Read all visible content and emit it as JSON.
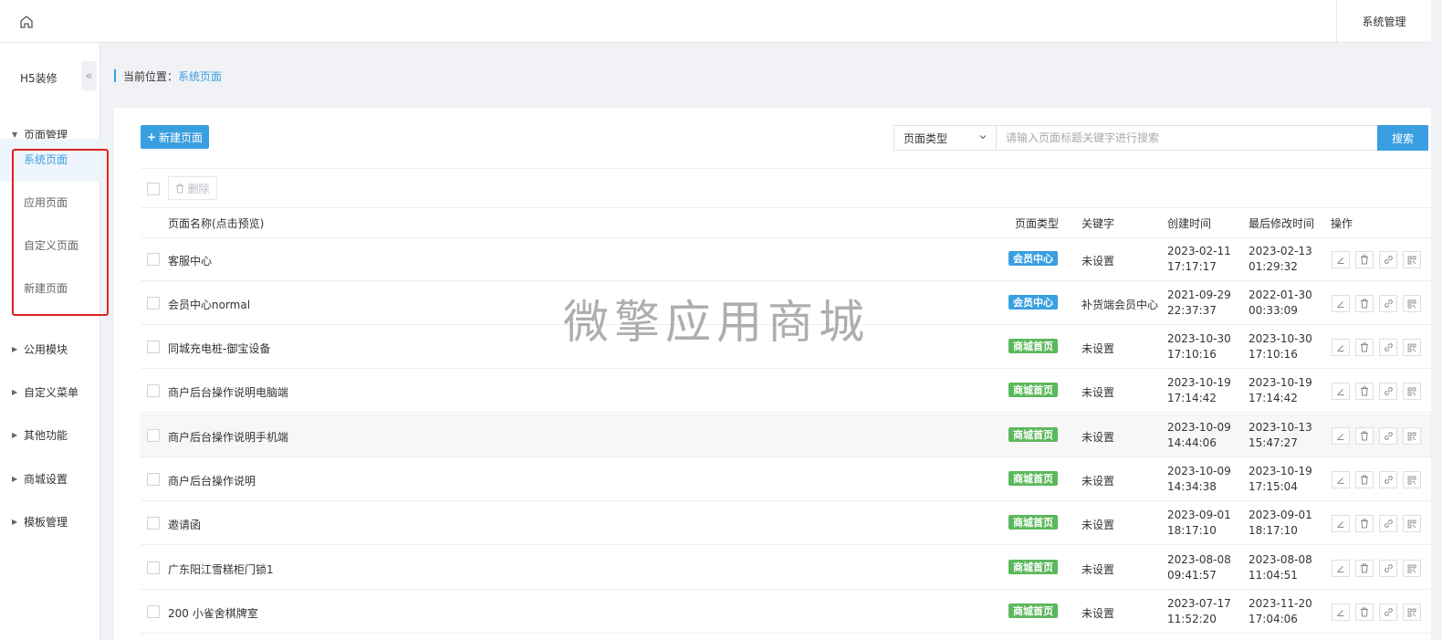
{
  "topbar": {
    "right_label": "系统管理"
  },
  "sidebar": {
    "brand": "H5装修",
    "collapse_glyph": "«",
    "groups": [
      {
        "label": "页面管理",
        "expanded": true
      },
      {
        "label": "公用模块"
      },
      {
        "label": "自定义菜单"
      },
      {
        "label": "其他功能"
      },
      {
        "label": "商城设置"
      },
      {
        "label": "模板管理"
      }
    ],
    "sub_items": [
      {
        "label": "系统页面",
        "active": true
      },
      {
        "label": "应用页面"
      },
      {
        "label": "自定义页面"
      },
      {
        "label": "新建页面"
      }
    ]
  },
  "breadcrumb": {
    "label": "当前位置：",
    "current": "系统页面"
  },
  "toolbar": {
    "new_page_label": "新建页面",
    "type_select_value": "页面类型",
    "search_placeholder": "请输入页面标题关键字进行搜索",
    "search_label": "搜索",
    "delete_label": "删除"
  },
  "table": {
    "headers": {
      "name": "页面名称(点击预览)",
      "type": "页面类型",
      "keyword": "关键字",
      "created": "创建时间",
      "modified": "最后修改时间",
      "ops": "操作"
    },
    "rows": [
      {
        "name": "客服中心",
        "type": "会员中心",
        "type_color": "#3a9fe0",
        "keyword": "未设置",
        "created_date": "2023-02-11",
        "created_time": "17:17:17",
        "modified_date": "2023-02-13",
        "modified_time": "01:29:32"
      },
      {
        "name": "会员中心normal",
        "type": "会员中心",
        "type_color": "#3a9fe0",
        "keyword": "补货端会员中心",
        "created_date": "2021-09-29",
        "created_time": "22:37:37",
        "modified_date": "2022-01-30",
        "modified_time": "00:33:09"
      },
      {
        "name": "同城充电桩-御宝设备",
        "type": "商城首页",
        "type_color": "#5cb85c",
        "keyword": "未设置",
        "created_date": "2023-10-30",
        "created_time": "17:10:16",
        "modified_date": "2023-10-30",
        "modified_time": "17:10:16"
      },
      {
        "name": "商户后台操作说明电脑端",
        "type": "商城首页",
        "type_color": "#5cb85c",
        "keyword": "未设置",
        "created_date": "2023-10-19",
        "created_time": "17:14:42",
        "modified_date": "2023-10-19",
        "modified_time": "17:14:42"
      },
      {
        "name": "商户后台操作说明手机端",
        "type": "商城首页",
        "type_color": "#5cb85c",
        "keyword": "未设置",
        "created_date": "2023-10-09",
        "created_time": "14:44:06",
        "modified_date": "2023-10-13",
        "modified_time": "15:47:27"
      },
      {
        "name": "商户后台操作说明",
        "type": "商城首页",
        "type_color": "#5cb85c",
        "keyword": "未设置",
        "created_date": "2023-10-09",
        "created_time": "14:34:38",
        "modified_date": "2023-10-19",
        "modified_time": "17:15:04"
      },
      {
        "name": "邀请函",
        "type": "商城首页",
        "type_color": "#5cb85c",
        "keyword": "未设置",
        "created_date": "2023-09-01",
        "created_time": "18:17:10",
        "modified_date": "2023-09-01",
        "modified_time": "18:17:10"
      },
      {
        "name": "广东阳江雪糕柜门锁1",
        "type": "商城首页",
        "type_color": "#5cb85c",
        "keyword": "未设置",
        "created_date": "2023-08-08",
        "created_time": "09:41:57",
        "modified_date": "2023-08-08",
        "modified_time": "11:04:51"
      },
      {
        "name": "200 小雀舍棋牌室",
        "type": "商城首页",
        "type_color": "#5cb85c",
        "keyword": "未设置",
        "created_date": "2023-07-17",
        "created_time": "11:52:20",
        "modified_date": "2023-11-20",
        "modified_time": "17:04:06"
      }
    ]
  },
  "watermark": "微擎应用商城"
}
